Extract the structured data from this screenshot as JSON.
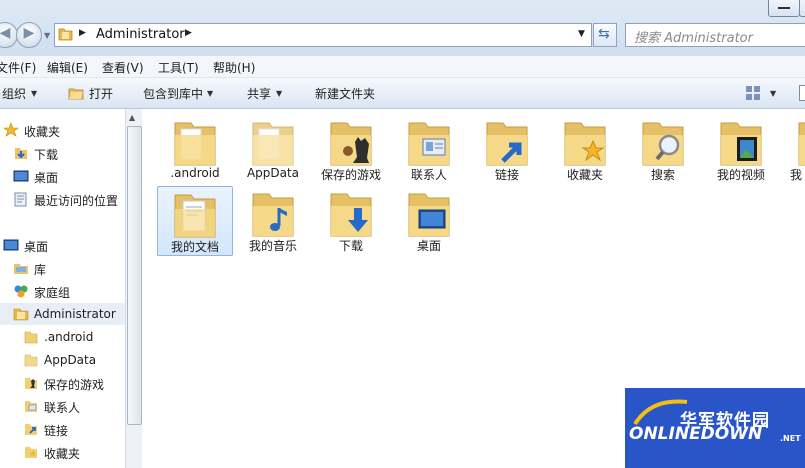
{
  "address_bar": {
    "path": "Administrator",
    "search_placeholder": "搜索 Administrator"
  },
  "menu": [
    "文件(F)",
    "编辑(E)",
    "查看(V)",
    "工具(T)",
    "帮助(H)"
  ],
  "toolbar": {
    "organize": "组织",
    "open": "打开",
    "include_in_library": "包含到库中",
    "share": "共享",
    "new_folder": "新建文件夹"
  },
  "nav_pane": {
    "favorites": {
      "label": "收藏夹",
      "items": [
        "下载",
        "桌面",
        "最近访问的位置"
      ]
    },
    "desktop": {
      "label": "桌面",
      "items": [
        "库",
        "家庭组",
        "Administrator"
      ]
    },
    "user_folders": [
      ".android",
      "AppData",
      "保存的游戏",
      "联系人",
      "链接",
      "收藏夹"
    ]
  },
  "content": {
    "items": [
      {
        "label": ".android",
        "icon": "plain-folder-icon"
      },
      {
        "label": "AppData",
        "icon": "hidden-folder-icon"
      },
      {
        "label": "保存的游戏",
        "icon": "chess-folder-icon"
      },
      {
        "label": "联系人",
        "icon": "contacts-folder-icon"
      },
      {
        "label": "链接",
        "icon": "link-arrow-folder-icon"
      },
      {
        "label": "收藏夹",
        "icon": "star-folder-icon"
      },
      {
        "label": "搜索",
        "icon": "magnifier-folder-icon"
      },
      {
        "label": "我的视频",
        "icon": "video-folder-icon"
      },
      {
        "label": "我",
        "icon": "folder-icon"
      },
      {
        "label": "我的文档",
        "icon": "documents-folder-icon"
      },
      {
        "label": "我的音乐",
        "icon": "music-folder-icon"
      },
      {
        "label": "下载",
        "icon": "download-arrow-folder-icon"
      },
      {
        "label": "桌面",
        "icon": "desktop-folder-icon"
      }
    ],
    "selected": "我的文档"
  },
  "watermark": {
    "cn": "华军软件园",
    "en": "ONLINEDOWN",
    "suffix": ".NET"
  },
  "colors": {
    "folder": "#f5d57a",
    "selection": "#d3e6fb",
    "watermark_bg": "#2a55c8"
  }
}
